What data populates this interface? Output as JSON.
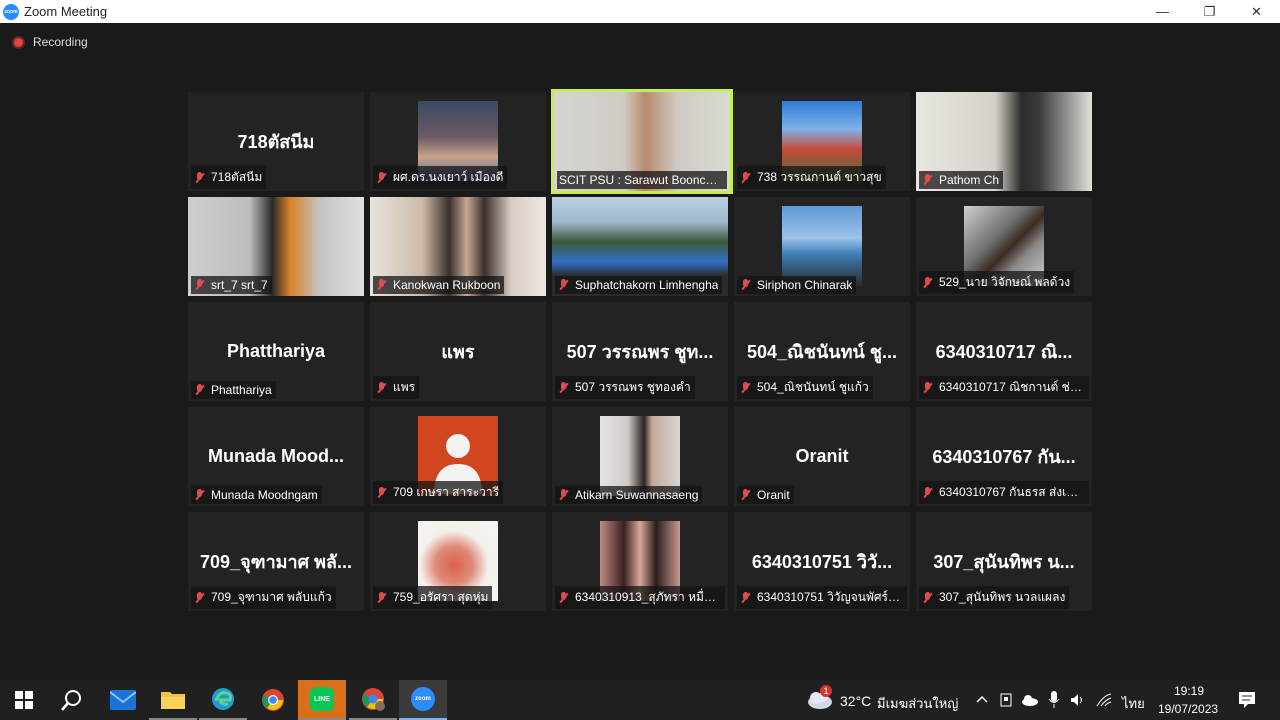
{
  "window": {
    "app_icon_text": "zoom",
    "title": "Zoom Meeting",
    "minimize_glyph": "—",
    "restore_glyph": "❐",
    "close_glyph": "✕"
  },
  "recording": {
    "label": "Recording"
  },
  "participants": [
    {
      "big": "718ตัสนีม",
      "label": "718ตัสนีม",
      "video": false
    },
    {
      "big": "",
      "label": "ผศ.ดร.นงเยาว์ เมืองดี",
      "video": true
    },
    {
      "big": "",
      "label": "SCIT PSU : Sarawut Boonchu...",
      "video": true,
      "active": true
    },
    {
      "big": "",
      "label": "738 วรรณกานต์ ขาวสุข",
      "video": true
    },
    {
      "big": "",
      "label": "Pathom Ch",
      "video": true
    },
    {
      "big": "",
      "label": "srt_7 srt_7",
      "video": true
    },
    {
      "big": "",
      "label": "Kanokwan Rukboon",
      "video": true
    },
    {
      "big": "",
      "label": "Suphatchakorn Limhengha",
      "video": true
    },
    {
      "big": "",
      "label": "Siriphon Chinarak",
      "video": true
    },
    {
      "big": "",
      "label": "529_นาย วิจักษณ์ พลด้วง",
      "video": true
    },
    {
      "big": "Phatthariya",
      "label": "Phatthariya",
      "video": false
    },
    {
      "big": "แพร",
      "label": "แพร",
      "video": false
    },
    {
      "big": "507 วรรณพร ชูท...",
      "label": "507 วรรณพร ชูทองคำ",
      "video": false
    },
    {
      "big": "504_ณิชนันทน์ ชู...",
      "label": "504_ณิชนันทน์ ชูแก้ว",
      "video": false
    },
    {
      "big": "6340310717 ณิ...",
      "label": "6340310717 ณิชกานต์ ช่าง...",
      "video": false
    },
    {
      "big": "Munada  Mood...",
      "label": "Munada Moodngam",
      "video": false
    },
    {
      "big": "",
      "label": "709 เกษรา สาระวารี",
      "video": true
    },
    {
      "big": "",
      "label": "Atikarn Suwannasaeng",
      "video": true
    },
    {
      "big": "Oranit",
      "label": "Oranit",
      "video": false
    },
    {
      "big": "6340310767 กัน...",
      "label": "6340310767 กันธรส ส่งเสมอ",
      "video": false
    },
    {
      "big": "709_จุฑามาศ พลั...",
      "label": "709_จุฑามาศ พลับแก้ว",
      "video": false
    },
    {
      "big": "",
      "label": "759_อรัศรา สุดหุ่ม",
      "video": true
    },
    {
      "big": "",
      "label": "6340310913_สุภัทรา หมื่นจร",
      "video": true
    },
    {
      "big": "6340310751 วิวั...",
      "label": "6340310751 วิวัญจนพัศร์ ต...",
      "video": false
    },
    {
      "big": "307_สุนันทิพร น...",
      "label": "307_สุนันทิพร นวลแผลง",
      "video": false
    }
  ],
  "taskbar": {
    "weather_badge": "1",
    "temperature": "32°C",
    "weather_text": "มีเมฆส่วนใหญ่",
    "language": "ไทย",
    "time": "19:19",
    "date": "19/07/2023",
    "zoom_text": "zoom",
    "line_text": "LINE"
  },
  "colors": {
    "active_speaker": "#c4f04a",
    "muted_mic": "#e34b4b",
    "recording": "#e8413b",
    "zoom_blue": "#2d8cff"
  }
}
